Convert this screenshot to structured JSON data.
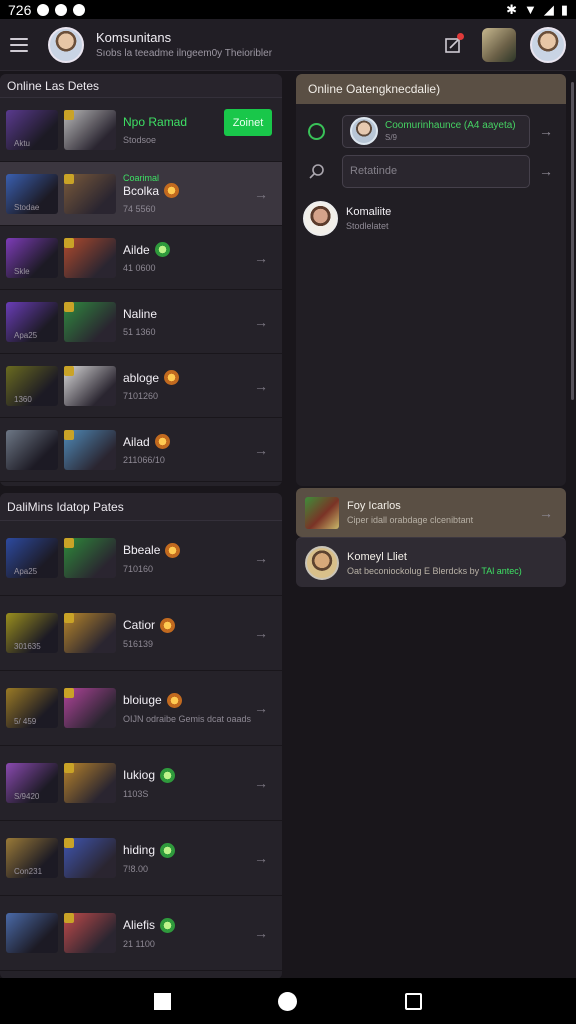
{
  "status_bar": {
    "time": "726"
  },
  "app_bar": {
    "title": "Komsunitans",
    "subtitle": "Sıobs la teeadme ilngeem0y Theioribler"
  },
  "left_top_panel": {
    "title": "Online Las Detes",
    "rows": [
      {
        "name": "Npo Ramad",
        "num": "Stodsoe",
        "tag": "Aktu",
        "cta": "Zoinet",
        "thumb_a": "#5a3a8f",
        "thumb_b": "#b8b8b8",
        "name_green": true
      },
      {
        "name": "Bcolka",
        "num": "74 5560",
        "tag": "Stodae",
        "extra": "Coarimal",
        "thumb_a": "#3a5fb0",
        "thumb_b": "#7a5a3b",
        "active": true,
        "rank": "orange"
      },
      {
        "name": "Ailde",
        "num": "41 0600",
        "tag": "Skle",
        "thumb_a": "#7d3cb8",
        "thumb_b": "#b04a2d",
        "rank": "green"
      },
      {
        "name": "Naline",
        "num": "51 1360",
        "tag": "Apa25",
        "thumb_a": "#6a3db8",
        "thumb_b": "#2f8a3f"
      },
      {
        "name": "abloge",
        "num": "7101260",
        "tag": "1360",
        "thumb_a": "#6a6b20",
        "thumb_b": "#d8d8d8",
        "rank": "orange"
      },
      {
        "name": "Ailad",
        "num": "211066/10",
        "tag": "",
        "thumb_a": "#6d7785",
        "thumb_b": "#4f8ab8",
        "rank": "orange"
      }
    ]
  },
  "left_bottom_panel": {
    "title": "DaliMins Idatop Pates",
    "rows": [
      {
        "name": "Bbeale",
        "num": "710160",
        "tag": "Apa25",
        "thumb_a": "#2d4aa0",
        "thumb_b": "#2e8a3a",
        "rank": "orange"
      },
      {
        "name": "Catior",
        "num": "516139",
        "tag": "301635",
        "thumb_a": "#9a8f1e",
        "thumb_b": "#b8862a",
        "rank": "orange"
      },
      {
        "name": "bloiuge",
        "num": "OIJN odraibe Gemis dcat oaads",
        "tag": "5/ 459",
        "thumb_a": "#9a7a25",
        "thumb_b": "#b0449a",
        "rank": "orange"
      },
      {
        "name": "Iukiog",
        "num": "1103S",
        "tag": "S/9420",
        "thumb_a": "#8a4ab0",
        "thumb_b": "#b8832b",
        "rank": "green"
      },
      {
        "name": "hiding",
        "num": "7!8.00",
        "tag": "Con231",
        "thumb_a": "#9a7a38",
        "thumb_b": "#3f55b0",
        "rank": "green"
      },
      {
        "name": "Aliefis",
        "num": "21 1100",
        "tag": "",
        "thumb_a": "#4a6aa8",
        "thumb_b": "#c04a4a",
        "rank": "green"
      }
    ]
  },
  "right_panel": {
    "title": "Online Oatengknecdalie)",
    "field1_line1": "Coomurinhaunce (A4 aayeta)",
    "field1_line2": "S/9",
    "field2_placeholder": "Retatinde",
    "user_name": "Komaliite",
    "user_sub": "Stodlelatet"
  },
  "card1": {
    "title": "Foy Icarlos",
    "sub": "Ciper idall orabdage clcenibtant"
  },
  "card2": {
    "title": "Komeyl Lliet",
    "sub": "Oat beconiockolug E Blerdcks by",
    "green": "TAl antec)"
  },
  "colors": {
    "accent_green": "#19c74a",
    "header_brown": "#5a4f44"
  }
}
